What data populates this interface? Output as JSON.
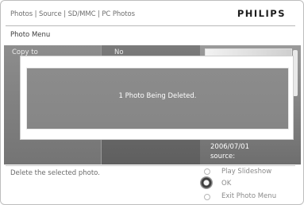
{
  "header": {
    "breadcrumb": "Photos | Source | SD/MMC | PC Photos",
    "brand": "PHILIPS"
  },
  "menu": {
    "title": "Photo Menu",
    "items": [
      {
        "label": "Copy to",
        "value": "No"
      }
    ]
  },
  "dialog": {
    "message": "1  Photo Being Deleted."
  },
  "photo": {
    "date": "2006/07/01",
    "source_label": "source:"
  },
  "footer": {
    "help_text": "Delete the selected photo.",
    "controls": {
      "up_label": "Play Slideshow",
      "ok_label": "OK",
      "down_label": "Exit Photo Menu"
    }
  }
}
